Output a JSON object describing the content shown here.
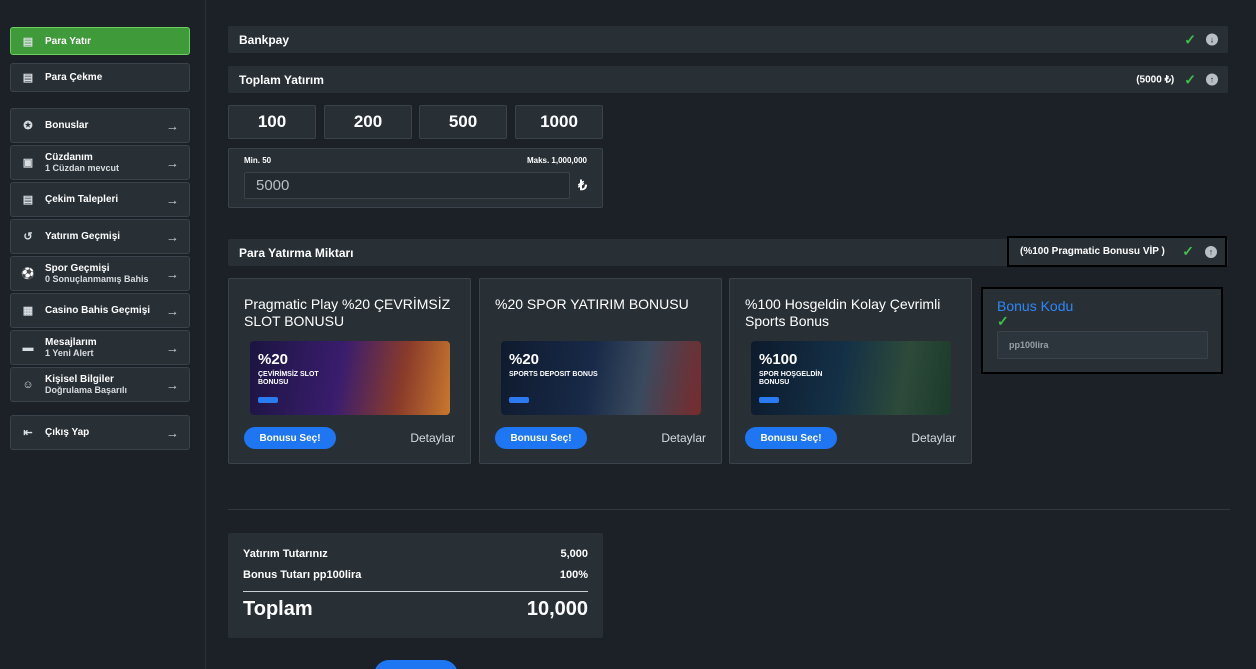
{
  "sidebar": {
    "items": [
      {
        "label": "Para Yatır",
        "sub": "",
        "icon": "deposit-icon",
        "active": true
      },
      {
        "label": "Para Çekme",
        "sub": "",
        "icon": "withdraw-icon",
        "active": false
      },
      {
        "label": "Bonuslar",
        "sub": "",
        "icon": "star-icon"
      },
      {
        "label": "Cüzdanım",
        "sub": "1 Cüzdan mevcut",
        "icon": "wallet-icon"
      },
      {
        "label": "Çekim Talepleri",
        "sub": "",
        "icon": "withdraw-requests-icon"
      },
      {
        "label": "Yatırım Geçmişi",
        "sub": "",
        "icon": "history-icon"
      },
      {
        "label": "Spor Geçmişi",
        "sub": "0 Sonuçlanmamış Bahis",
        "icon": "soccer-ball-icon"
      },
      {
        "label": "Casino Bahis Geçmişi",
        "sub": "",
        "icon": "casino-icon"
      },
      {
        "label": "Mesajlarım",
        "sub": "1 Yeni Alert",
        "icon": "message-icon"
      },
      {
        "label": "Kişisel Bilgiler",
        "sub": "Doğrulama Başarılı",
        "icon": "user-icon"
      },
      {
        "label": "Çıkış Yap",
        "sub": "",
        "icon": "logout-icon"
      }
    ]
  },
  "method": {
    "label": "Bankpay"
  },
  "total_deposit": {
    "label": "Toplam Yatırım",
    "value": "(5000 ₺)"
  },
  "amounts": [
    "100",
    "200",
    "500",
    "1000"
  ],
  "amount_input": {
    "min_label": "Min. 50",
    "max_label": "Maks. 1,000,000",
    "value": "5000",
    "currency": "₺"
  },
  "bonus_section": {
    "label": "Para Yatırma Miktarı",
    "selected": "(%100 Pragmatic Bonusu VİP )"
  },
  "bonus_cards": [
    {
      "title": "Pragmatic Play %20 ÇEVRİMSİZ SLOT BONUSU",
      "banner_pct": "%20",
      "banner_text": "ÇEVİRİMSİZ SLOT BONUSU",
      "select": "Bonusu Seç!",
      "details": "Detaylar"
    },
    {
      "title": "%20 SPOR YATIRIM BONUSU",
      "banner_pct": "%20",
      "banner_text": "SPORTS DEPOSIT BONUS",
      "select": "Bonusu Seç!",
      "details": "Detaylar"
    },
    {
      "title": "%100 Hosgeldin Kolay Çevrimli Sports Bonus",
      "banner_pct": "%100",
      "banner_text": "SPOR HOŞGELDİN BONUSU",
      "select": "Bonusu Seç!",
      "details": "Detaylar"
    }
  ],
  "bonus_code": {
    "label": "Bonus Kodu",
    "value": "pp100lira"
  },
  "summary": {
    "deposit_label": "Yatırım Tutarınız",
    "deposit_value": "5,000",
    "bonus_label": "Bonus Tutarı pp100lira",
    "bonus_value": "100%",
    "total_label": "Toplam",
    "total_value": "10,000"
  },
  "colors": {
    "accent_green": "#3f9b3a",
    "accent_blue": "#1e76f2",
    "check_green": "#3fc04a"
  }
}
